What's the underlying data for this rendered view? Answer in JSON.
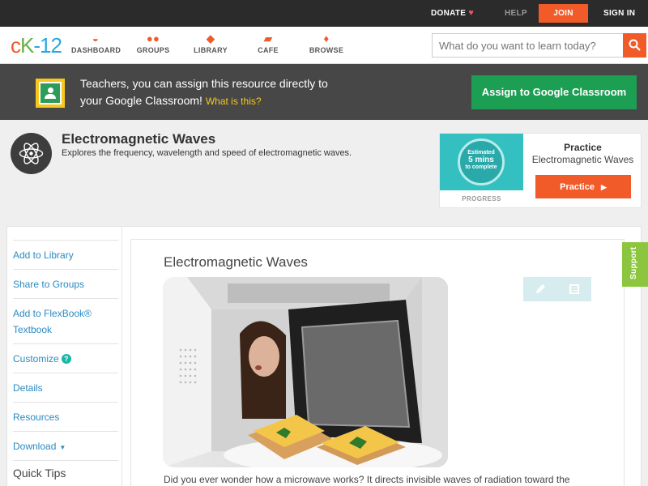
{
  "topbar": {
    "donate": "DONATE",
    "help": "HELP",
    "join": "JOIN",
    "signin": "SIGN IN"
  },
  "logo": {
    "part1": "c",
    "part2": "K",
    "part3": "-12"
  },
  "nav": {
    "dashboard": "DASHBOARD",
    "groups": "GROUPS",
    "library": "LIBRARY",
    "cafe": "CAFE",
    "browse": "BROWSE"
  },
  "search": {
    "placeholder": "What do you want to learn today?"
  },
  "classroom": {
    "line1": "Teachers, you can assign this resource directly to",
    "line2": "your Google Classroom!",
    "what": "What is this?",
    "button": "Assign to Google Classroom"
  },
  "concept": {
    "title": "Electromagnetic Waves",
    "description": "Explores the frequency, wavelength and speed of electromagnetic waves."
  },
  "practice": {
    "estimated": "Estimated",
    "mins": "5 mins",
    "to_complete": "to complete",
    "progress_label": "PROGRESS",
    "heading": "Practice",
    "subtitle": "Electromagnetic Waves",
    "button": "Practice"
  },
  "sidebar": {
    "items": [
      {
        "label": "Add to Library"
      },
      {
        "label": "Share to Groups"
      },
      {
        "label": "Add to FlexBook® Textbook"
      },
      {
        "label": "Customize"
      },
      {
        "label": "Details"
      },
      {
        "label": "Resources"
      },
      {
        "label": "Download"
      }
    ],
    "quick_tips": "Quick Tips"
  },
  "article": {
    "title": "Electromagnetic Waves",
    "text": "Did you ever wonder how a microwave works? It directs invisible waves of radiation toward the"
  },
  "support": "Support",
  "colors": {
    "accent": "#f15a29",
    "classroom_green": "#1d9f53",
    "link": "#2a8ac2",
    "support_green": "#8cc63f"
  }
}
